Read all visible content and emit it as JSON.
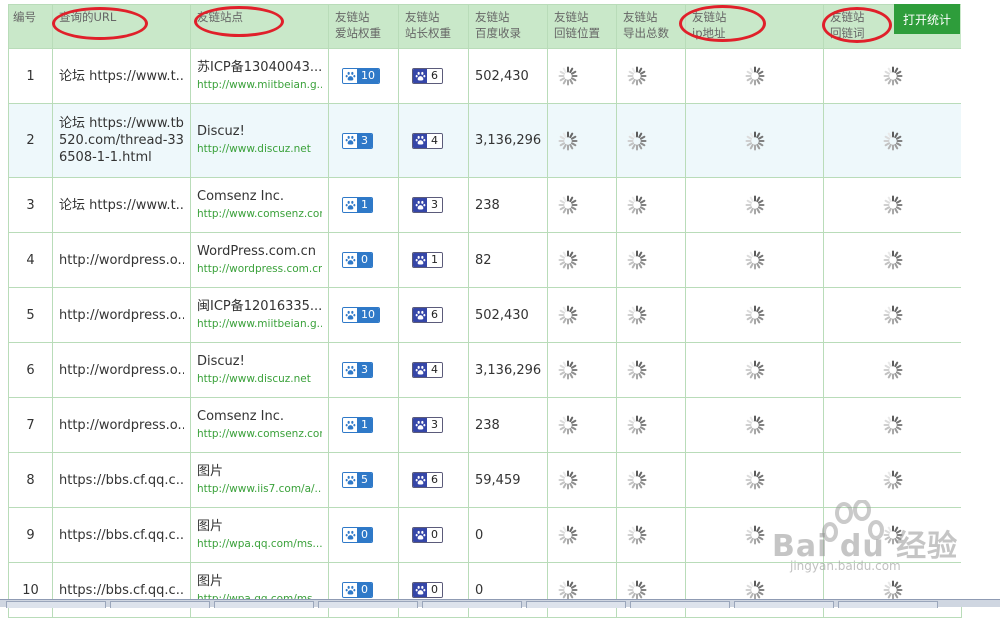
{
  "columns": {
    "id": "编号",
    "query_url": "查询的URL",
    "site": "友链站点",
    "aizhan": [
      "友链站",
      "爱站权重"
    ],
    "zhanzhang": [
      "友链站",
      "站长权重"
    ],
    "baidu": [
      "友链站",
      "百度收录"
    ],
    "backlink_pos": [
      "友链站",
      "回链位置"
    ],
    "export_total": [
      "友链站",
      "导出总数"
    ],
    "ip": [
      "友链站",
      "ip地址"
    ],
    "backlink_word": [
      "友链站",
      "回链词"
    ]
  },
  "open_stats_button": "打开统计",
  "rows": [
    {
      "id": "1",
      "url": "论坛 https://www.t...",
      "site_name": "苏ICP备13040043...",
      "site_url": "http://www.miitbeian.g...",
      "aizhan": "10",
      "zhanzhang": "6",
      "baidu": "502,430"
    },
    {
      "id": "2",
      "url": "论坛 https://www.tb520.com/thread-336508-1-1.html",
      "site_name": "Discuz!",
      "site_url": "http://www.discuz.net",
      "aizhan": "3",
      "zhanzhang": "4",
      "baidu": "3,136,296"
    },
    {
      "id": "3",
      "url": "论坛 https://www.t...",
      "site_name": "Comsenz Inc.",
      "site_url": "http://www.comsenz.com",
      "aizhan": "1",
      "zhanzhang": "3",
      "baidu": "238"
    },
    {
      "id": "4",
      "url": "http://wordpress.o...",
      "site_name": "WordPress.com.cn",
      "site_url": "http://wordpress.com.cn",
      "aizhan": "0",
      "zhanzhang": "1",
      "baidu": "82"
    },
    {
      "id": "5",
      "url": "http://wordpress.o...",
      "site_name": "闽ICP备12016335...",
      "site_url": "http://www.miitbeian.g...",
      "aizhan": "10",
      "zhanzhang": "6",
      "baidu": "502,430"
    },
    {
      "id": "6",
      "url": "http://wordpress.o...",
      "site_name": "Discuz!",
      "site_url": "http://www.discuz.net",
      "aizhan": "3",
      "zhanzhang": "4",
      "baidu": "3,136,296"
    },
    {
      "id": "7",
      "url": "http://wordpress.o...",
      "site_name": "Comsenz Inc.",
      "site_url": "http://www.comsenz.com",
      "aizhan": "1",
      "zhanzhang": "3",
      "baidu": "238"
    },
    {
      "id": "8",
      "url": "https://bbs.cf.qq.c...",
      "site_name": "图片",
      "site_url": "http://www.iis7.com/a/...",
      "aizhan": "5",
      "zhanzhang": "6",
      "baidu": "59,459"
    },
    {
      "id": "9",
      "url": "https://bbs.cf.qq.c...",
      "site_name": "图片",
      "site_url": "http://wpa.qq.com/ms...",
      "aizhan": "0",
      "zhanzhang": "0",
      "baidu": "0"
    },
    {
      "id": "10",
      "url": "https://bbs.cf.qq.c...",
      "site_name": "图片",
      "site_url": "http://wpa.qq.com/ms...",
      "aizhan": "0",
      "zhanzhang": "0",
      "baidu": "0"
    }
  ],
  "watermark": {
    "brand": "Bai du 经验",
    "sub": "jingyan.baidu.com"
  },
  "icons": {
    "aizhan_badge": "paw-icon",
    "zhanzhang_badge": "paw-icon",
    "loading": "spinner-icon"
  },
  "colors": {
    "header_bg": "#c9e8c9",
    "accent_green": "#2e9d3b",
    "link_green": "#3aa13a",
    "alt_row": "#eef8fb",
    "annotation_red": "#e0202a"
  }
}
